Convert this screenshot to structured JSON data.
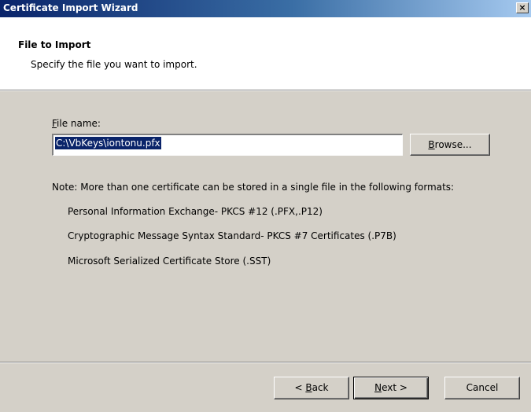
{
  "window": {
    "title": "Certificate Import Wizard",
    "close_label": "×"
  },
  "header": {
    "title": "File to Import",
    "subtitle": "Specify the file you want to import."
  },
  "file": {
    "label_mnemonic": "F",
    "label_rest": "ile name:",
    "value": "C:\\VbKeys\\iontonu.pfx",
    "browse_pre": "B",
    "browse_rest": "rowse..."
  },
  "note": {
    "text": "Note:  More than one certificate can be stored in a single file in the following formats:",
    "formats": [
      "Personal Information Exchange- PKCS #12 (.PFX,.P12)",
      "Cryptographic Message Syntax Standard- PKCS #7 Certificates (.P7B)",
      "Microsoft Serialized Certificate Store (.SST)"
    ]
  },
  "buttons": {
    "back_prefix": "< ",
    "back_mnemonic": "B",
    "back_rest": "ack",
    "next_mnemonic": "N",
    "next_rest": "ext >",
    "cancel": "Cancel"
  }
}
